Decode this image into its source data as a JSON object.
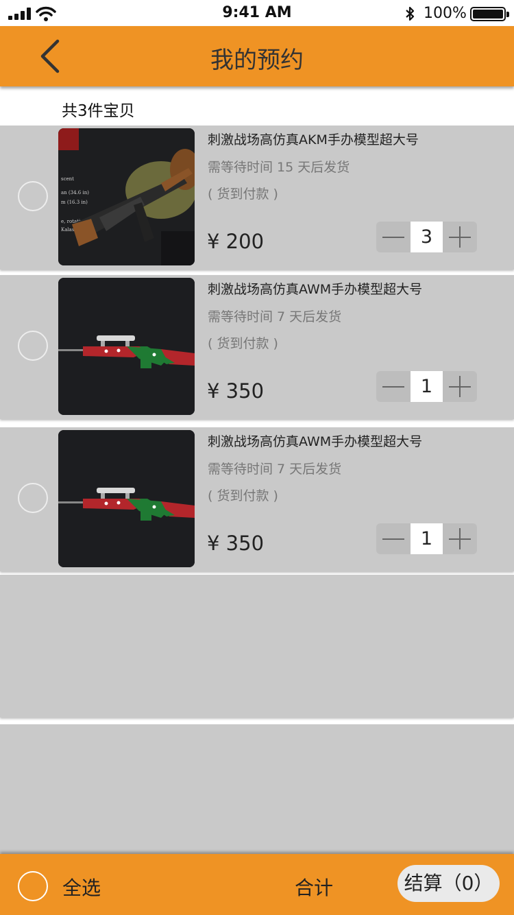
{
  "status_bar": {
    "time": "9:41 AM",
    "battery": "100%",
    "icons": [
      "signal-icon",
      "wifi-icon",
      "bluetooth-icon",
      "battery-icon"
    ]
  },
  "nav": {
    "title": "我的预约",
    "back_icon": "chevron-left-icon"
  },
  "summary": "共3件宝贝",
  "items": [
    {
      "name": "刺激战场高仿真AKM手办模型超大号",
      "wait": "需等待时间 15 天后发货",
      "payment": "( 货到付款 )",
      "price": "¥ 200",
      "quantity": "3",
      "image": "akm-rifle-photo"
    },
    {
      "name": "刺激战场高仿真AWM手办模型超大号",
      "wait": "需等待时间 7 天后发货",
      "payment": "( 货到付款 )",
      "price": "¥ 350",
      "quantity": "1",
      "image": "awm-sniper-rifle-photo"
    },
    {
      "name": "刺激战场高仿真AWM手办模型超大号",
      "wait": "需等待时间 7 天后发货",
      "payment": "( 货到付款 )",
      "price": "¥ 350",
      "quantity": "1",
      "image": "awm-sniper-rifle-photo"
    }
  ],
  "footer": {
    "select_all": "全选",
    "total_label": "合计",
    "checkout": "结算（0）"
  },
  "colors": {
    "brand": "#ef9324",
    "list_bg": "#c9c9c9",
    "stepper_bg": "#bdbdbd"
  }
}
